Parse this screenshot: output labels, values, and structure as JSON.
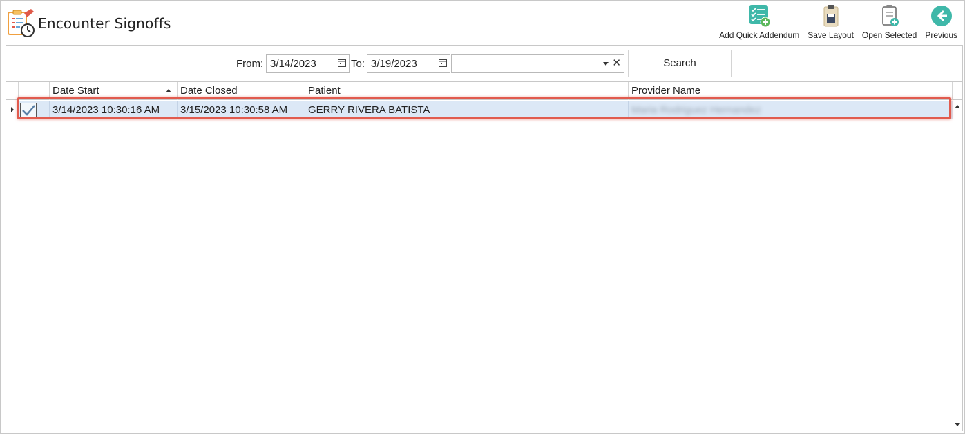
{
  "header": {
    "title": "Encounter Signoffs",
    "app_icon": "clipboard-clock-icon"
  },
  "toolbar": {
    "items": [
      {
        "label": "Add Quick Addendum",
        "icon": "checklist-add-icon"
      },
      {
        "label": "Save Layout",
        "icon": "clipboard-save-icon"
      },
      {
        "label": "Open Selected",
        "icon": "document-add-icon"
      },
      {
        "label": "Previous",
        "icon": "arrow-left-circle-icon"
      }
    ]
  },
  "filters": {
    "from_label": "From:",
    "from_value": "3/14/2023",
    "to_label": "To:",
    "to_value": "3/19/2023",
    "combo_value": "",
    "clear_glyph": "✕",
    "search_label": "Search"
  },
  "grid": {
    "columns": [
      "Date Start",
      "Date Closed",
      "Patient",
      "Provider Name"
    ],
    "sorted_column": "Date Start",
    "rows": [
      {
        "checked": true,
        "date_start": "3/14/2023 10:30:16 AM",
        "date_closed": "3/15/2023 10:30:58 AM",
        "patient": "GERRY RIVERA BATISTA",
        "provider_name": "Maria Rodriguez Hernandez"
      }
    ]
  },
  "colors": {
    "selected_row": "#dce8f6",
    "highlight_border": "#e15b4e",
    "teal_icon": "#3fb8a9",
    "green_badge": "#5cb85c"
  }
}
